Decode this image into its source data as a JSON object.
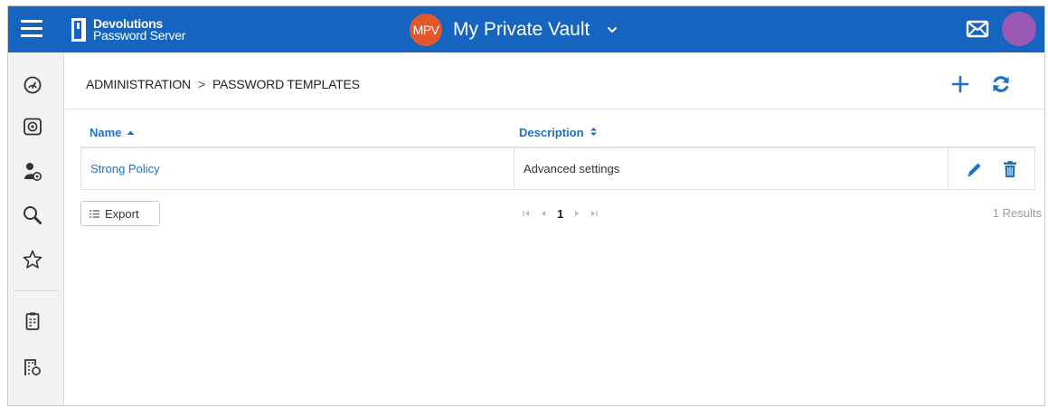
{
  "topbar": {
    "logo_line1": "Devolutions",
    "logo_line2": "Password Server",
    "vault_badge": "MPV",
    "vault_name": "My Private Vault"
  },
  "sidebar": {
    "items": [
      {
        "icon": "dashboard-icon"
      },
      {
        "icon": "vault-icon"
      },
      {
        "icon": "user-settings-icon"
      },
      {
        "icon": "search-icon"
      },
      {
        "icon": "star-icon"
      },
      {
        "icon": "clipboard-icon"
      },
      {
        "icon": "building-icon"
      }
    ]
  },
  "breadcrumb": {
    "parent": "ADMINISTRATION",
    "separator": ">",
    "current": "PASSWORD TEMPLATES"
  },
  "table": {
    "columns": [
      {
        "label": "Name",
        "sort": "ascending"
      },
      {
        "label": "Description",
        "sort": "both"
      }
    ],
    "rows": [
      {
        "name": "Strong Policy",
        "description": "Advanced settings"
      }
    ]
  },
  "footer": {
    "export_label": "Export",
    "current_page": "1",
    "results": "1 Results"
  },
  "colors": {
    "topbar": "#1565c0",
    "link": "#1f6fc3",
    "vault_badge": "#e2572b",
    "avatar": "#9b59b6"
  }
}
